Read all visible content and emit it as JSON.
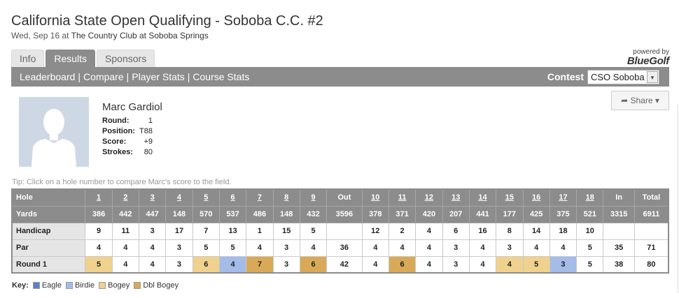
{
  "page": {
    "title": "California State Open Qualifying - Soboba C.C. #2",
    "date": "Wed, Sep 16 at",
    "venue": "The Country Club at Soboba Springs"
  },
  "tabs": [
    "Info",
    "Results",
    "Sponsors"
  ],
  "powered_by": {
    "small": "powered by",
    "logo": "BlueGolf"
  },
  "nav": {
    "links": [
      "Leaderboard",
      "Compare",
      "Player Stats",
      "Course Stats"
    ],
    "separator": "|",
    "contest_label": "Contest",
    "contest_value": "CSO Soboba",
    "contest_arrow": "▾"
  },
  "share": {
    "icon": "➦",
    "label": "Share",
    "caret": "▾"
  },
  "player": {
    "name": "Marc Gardiol",
    "stats": [
      {
        "label": "Round:",
        "value": "1"
      },
      {
        "label": "Position:",
        "value": "T88"
      },
      {
        "label": "Score:",
        "value": "+9"
      },
      {
        "label": "Strokes:",
        "value": "80"
      }
    ]
  },
  "tip": "Tip: Click on a hole number to compare Marc's score to the field.",
  "scorecard": {
    "header": [
      "Hole",
      "1",
      "2",
      "3",
      "4",
      "5",
      "6",
      "7",
      "8",
      "9",
      "Out",
      "10",
      "11",
      "12",
      "13",
      "14",
      "15",
      "16",
      "17",
      "18",
      "In",
      "Total"
    ],
    "yards": [
      "Yards",
      "386",
      "442",
      "447",
      "148",
      "570",
      "537",
      "486",
      "148",
      "432",
      "3596",
      "378",
      "371",
      "420",
      "207",
      "441",
      "177",
      "425",
      "375",
      "521",
      "3315",
      "6911"
    ],
    "handicap": [
      "Handicap",
      "9",
      "11",
      "3",
      "17",
      "7",
      "13",
      "1",
      "15",
      "5",
      "",
      "12",
      "2",
      "4",
      "6",
      "16",
      "8",
      "14",
      "18",
      "10",
      "",
      ""
    ],
    "par": [
      "Par",
      "4",
      "4",
      "4",
      "3",
      "5",
      "5",
      "4",
      "3",
      "4",
      "36",
      "4",
      "4",
      "4",
      "3",
      "4",
      "3",
      "4",
      "4",
      "5",
      "35",
      "71"
    ],
    "round": [
      "Round 1",
      "5",
      "4",
      "4",
      "3",
      "6",
      "4",
      "7",
      "3",
      "6",
      "42",
      "4",
      "6",
      "4",
      "3",
      "4",
      "4",
      "5",
      "3",
      "5",
      "38",
      "80"
    ],
    "round_classes": [
      "lbl",
      "c-bogey",
      "",
      "",
      "",
      "c-bogey",
      "c-birdie",
      "c-dbl",
      "",
      "c-dbl",
      "",
      "",
      "c-dbl",
      "",
      "",
      "",
      "c-bogey",
      "c-bogey",
      "c-birdie",
      "",
      "",
      ""
    ]
  },
  "key": {
    "label": "Key:",
    "items": [
      {
        "name": "Eagle",
        "color": "#5d7ec9"
      },
      {
        "name": "Birdie",
        "color": "#a4bce8"
      },
      {
        "name": "Bogey",
        "color": "#f0d28e"
      },
      {
        "name": "Dbl Bogey",
        "color": "#d8aa58"
      }
    ]
  }
}
